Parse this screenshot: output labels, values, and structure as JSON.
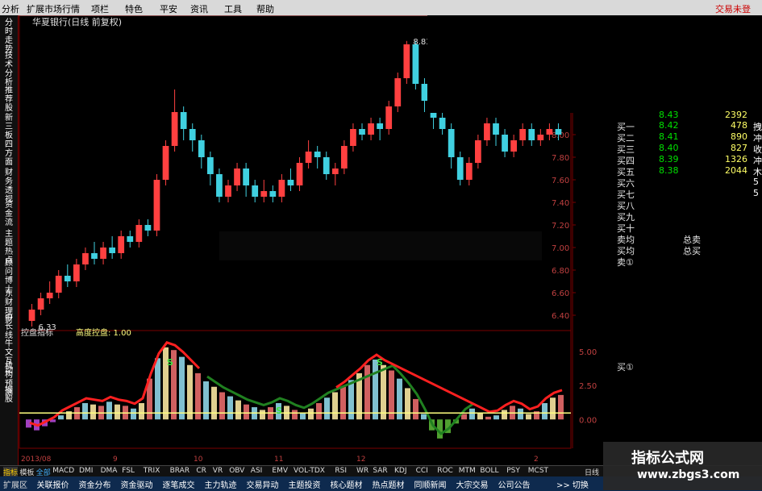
{
  "menubar": {
    "items": [
      "分析",
      "扩展市场行情",
      "项栏",
      "特色",
      "平安",
      "资讯",
      "工具",
      "帮助"
    ],
    "trade": "交易未登"
  },
  "leftbar": {
    "tabs": [
      "分时走势",
      "技术分析",
      "推荐股",
      "新三板",
      "四方面",
      "财务透视",
      "资金流",
      "主题热点",
      "顾问博士",
      "东财理财",
      "中长线",
      "牛文互动",
      "机构预测",
      "搜股"
    ]
  },
  "chart": {
    "title": "华夏银行(日线 前复权)",
    "high_label": "8.83",
    "low_label": "6.33",
    "price_ticks": [
      "8.00",
      "7.80",
      "7.60",
      "7.40",
      "7.20",
      "7.00",
      "6.80",
      "6.60",
      "6.40"
    ],
    "indicator_title": "控盘指标",
    "indicator_value": "高度控盘: 1.00",
    "indicator_ticks": [
      "5.00",
      "2.50",
      "0.00"
    ],
    "date_labels": [
      "2013/08",
      "9",
      "10",
      "11",
      "12",
      "2"
    ],
    "s_marker": "S",
    "corner_label": "分析"
  },
  "chart_data": {
    "type": "candlestick",
    "title": "华夏银行(日线 前复权)",
    "annotations": [
      "8.83",
      "6.33"
    ],
    "ylim": [
      6.3,
      8.9
    ],
    "candles": [
      [
        6.35,
        6.45,
        6.3,
        6.5
      ],
      [
        6.45,
        6.55,
        6.4,
        6.6
      ],
      [
        6.55,
        6.6,
        6.5,
        6.7
      ],
      [
        6.6,
        6.75,
        6.55,
        6.8
      ],
      [
        6.75,
        6.7,
        6.65,
        6.85
      ],
      [
        6.7,
        6.85,
        6.65,
        6.9
      ],
      [
        6.85,
        6.95,
        6.8,
        7.0
      ],
      [
        6.95,
        6.9,
        6.85,
        7.05
      ],
      [
        6.9,
        7.0,
        6.85,
        7.05
      ],
      [
        7.0,
        6.95,
        6.9,
        7.1
      ],
      [
        6.95,
        7.1,
        6.9,
        7.15
      ],
      [
        7.1,
        7.05,
        7.0,
        7.15
      ],
      [
        7.05,
        7.2,
        7.0,
        7.25
      ],
      [
        7.2,
        7.15,
        7.1,
        7.25
      ],
      [
        7.15,
        7.6,
        7.1,
        7.65
      ],
      [
        7.6,
        7.9,
        7.55,
        7.95
      ],
      [
        7.9,
        8.2,
        7.85,
        8.4
      ],
      [
        8.2,
        8.05,
        7.95,
        8.25
      ],
      [
        8.05,
        7.95,
        7.85,
        8.1
      ],
      [
        7.95,
        7.8,
        7.7,
        8.0
      ],
      [
        7.8,
        7.65,
        7.55,
        7.85
      ],
      [
        7.65,
        7.45,
        7.4,
        7.7
      ],
      [
        7.45,
        7.55,
        7.4,
        7.6
      ],
      [
        7.55,
        7.7,
        7.5,
        7.75
      ],
      [
        7.7,
        7.55,
        7.45,
        7.75
      ],
      [
        7.55,
        7.45,
        7.4,
        7.6
      ],
      [
        7.45,
        7.5,
        7.4,
        7.6
      ],
      [
        7.5,
        7.45,
        7.4,
        7.55
      ],
      [
        7.45,
        7.6,
        7.4,
        7.65
      ],
      [
        7.6,
        7.55,
        7.5,
        7.7
      ],
      [
        7.55,
        7.75,
        7.5,
        7.8
      ],
      [
        7.75,
        7.85,
        7.7,
        7.95
      ],
      [
        7.85,
        7.8,
        7.7,
        7.9
      ],
      [
        7.8,
        7.65,
        7.6,
        7.85
      ],
      [
        7.65,
        7.7,
        7.55,
        7.75
      ],
      [
        7.7,
        7.9,
        7.65,
        7.95
      ],
      [
        7.9,
        8.05,
        7.85,
        8.1
      ],
      [
        8.05,
        8.0,
        7.95,
        8.1
      ],
      [
        8.0,
        8.1,
        7.95,
        8.15
      ],
      [
        8.1,
        8.05,
        7.95,
        8.15
      ],
      [
        8.05,
        8.25,
        8.0,
        8.3
      ],
      [
        8.25,
        8.5,
        8.2,
        8.55
      ],
      [
        8.5,
        8.8,
        8.45,
        8.83
      ],
      [
        8.8,
        8.45,
        8.4,
        8.83
      ],
      [
        8.45,
        8.3,
        8.2,
        8.5
      ],
      [
        8.3,
        8.15,
        8.05,
        8.35
      ],
      [
        8.15,
        8.05,
        8.0,
        8.2
      ],
      [
        8.05,
        7.8,
        7.7,
        8.1
      ],
      [
        7.8,
        7.6,
        7.55,
        7.85
      ],
      [
        7.6,
        7.75,
        7.55,
        7.8
      ],
      [
        7.75,
        7.95,
        7.7,
        8.0
      ],
      [
        7.95,
        8.1,
        7.9,
        8.15
      ],
      [
        8.1,
        8.0,
        7.9,
        8.15
      ],
      [
        8.0,
        7.85,
        7.8,
        8.05
      ],
      [
        7.85,
        7.95,
        7.8,
        8.0
      ],
      [
        7.95,
        8.05,
        7.9,
        8.1
      ],
      [
        8.05,
        7.95,
        7.9,
        8.1
      ],
      [
        7.95,
        8.0,
        7.9,
        8.05
      ],
      [
        8.0,
        8.05,
        7.95,
        8.1
      ],
      [
        8.05,
        8.0,
        7.95,
        8.1
      ]
    ],
    "indicator": {
      "name": "控盘指标",
      "ylim": [
        -2,
        6
      ],
      "bars": [
        -0.6,
        -0.8,
        -0.5,
        -0.2,
        0.3,
        0.6,
        0.9,
        1.2,
        1.1,
        1.0,
        1.3,
        1.1,
        1.0,
        0.8,
        1.2,
        3.0,
        4.5,
        5.3,
        5.1,
        4.6,
        4.0,
        3.4,
        2.8,
        2.4,
        2.0,
        1.7,
        1.4,
        1.1,
        0.9,
        0.7,
        0.9,
        1.2,
        1.0,
        0.7,
        0.5,
        0.8,
        1.2,
        1.6,
        2.0,
        2.4,
        2.9,
        3.4,
        4.0,
        4.4,
        4.0,
        3.6,
        3.0,
        2.3,
        1.5,
        0.4,
        -0.8,
        -1.4,
        -1.0,
        -0.3,
        0.4,
        0.8,
        0.5,
        0.2,
        0.3,
        0.7,
        1.0,
        0.8,
        0.4,
        0.6,
        1.2,
        1.6,
        1.8
      ],
      "control_level": 1.0
    }
  },
  "quote": {
    "rows": [
      {
        "label": "买一",
        "price": "8.42",
        "vol": "478",
        "side": "拽"
      },
      {
        "label": "买二",
        "price": "8.41",
        "vol": "890",
        "side": "冲"
      },
      {
        "label": "买三",
        "price": "8.40",
        "vol": "827",
        "side": "收"
      },
      {
        "label": "买四",
        "price": "8.39",
        "vol": "1326",
        "side": "冲"
      },
      {
        "label": "买五",
        "price": "8.38",
        "vol": "2044",
        "side": "木"
      },
      {
        "label": "买六",
        "price": "",
        "vol": "",
        "side": "5"
      },
      {
        "label": "买七",
        "price": "",
        "vol": "",
        "side": "5"
      },
      {
        "label": "买八",
        "price": "",
        "vol": "",
        "side": ""
      },
      {
        "label": "买九",
        "price": "",
        "vol": "",
        "side": ""
      },
      {
        "label": "买十",
        "price": "",
        "vol": "",
        "side": ""
      },
      {
        "label": "卖均",
        "price": "总卖",
        "vol": "",
        "side": ""
      },
      {
        "label": "买均",
        "price": "总买",
        "vol": "",
        "side": ""
      },
      {
        "label": "卖①",
        "price": "",
        "vol": "",
        "side": ""
      }
    ],
    "top_partial": "8.43",
    "top_partial_vol": "2392",
    "buy_one_lower": "买①"
  },
  "tabbar": {
    "tabs": [
      "指标",
      "模板",
      "全部",
      "MACD",
      "DMI",
      "DMA",
      "FSL",
      "TRIX",
      "BRAR",
      "CR",
      "VR",
      "OBV",
      "ASI",
      "EMV",
      "VOL-TDX",
      "RSI",
      "WR",
      "SAR",
      "KDJ",
      "CCI",
      "ROC",
      "MTM",
      "BOLL",
      "PSY",
      "MCST"
    ],
    "right_label": "日线"
  },
  "bottombar": {
    "items": [
      "扩展区",
      "关联报价",
      "资金分布",
      "资金驱动",
      "逐笔成交",
      "主力轨迹",
      "交易异动",
      "主题投资",
      "核心题材",
      "热点题材",
      "同顺新闻",
      "大宗交易",
      "公司公告"
    ],
    "right": ">>  切换"
  },
  "watermark": {
    "line1": "指标公式网",
    "line2": "www.zbgs3.com"
  },
  "colors": {
    "up": "#ff4040",
    "down": "#40d0e0",
    "bull": "#ff2020",
    "bear": "#208020",
    "ctrl": "#ffff80",
    "grid": "#7a0000"
  }
}
